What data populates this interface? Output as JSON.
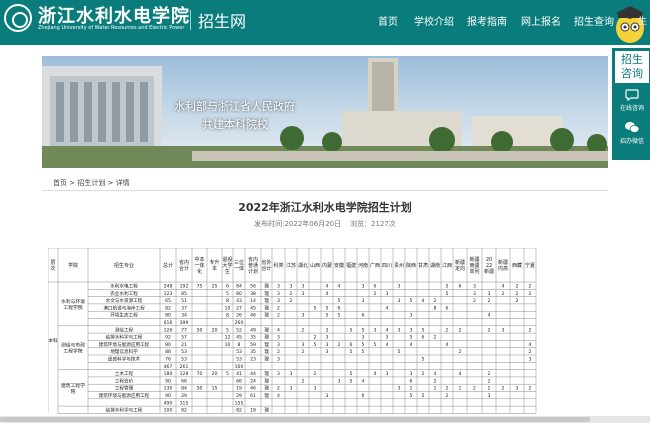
{
  "header": {
    "school_name_cn": "浙江水利水电学院",
    "school_name_en": "Zhejiang University of Water Resources and Electric Power",
    "site_name": "招生网",
    "nav": [
      "首页",
      "学校介绍",
      "报考指南",
      "网上报名",
      "招生查询"
    ],
    "mascot_text": "生"
  },
  "side_panel": {
    "title_line1": "招生",
    "title_line2": "咨询",
    "online": "在线咨询",
    "wechat": "招办微信"
  },
  "banner": {
    "line1": "水利部与浙江省人民政府",
    "line2": "共建本科院校"
  },
  "breadcrumb": [
    "首页",
    "招生计划",
    "详情"
  ],
  "breadcrumb_sep": ">",
  "article": {
    "title": "2022年浙江水利水电学院招生计划",
    "publish_label": "发布时间:2022年06月20日",
    "views": "浏览：2127次"
  },
  "table": {
    "headers": [
      "层次",
      "学院",
      "招生专业",
      "总计",
      "省内合计",
      "中本一体化",
      "专升本",
      "退役大学生",
      "三位一体",
      "省内普通计划",
      "省外合计",
      "科类",
      "江苏",
      "湖北",
      "山西",
      "内蒙",
      "安徽",
      "福建",
      "河南",
      "广西",
      "四川",
      "贵州",
      "陕西",
      "甘肃",
      "湖南",
      "江西",
      "新疆定向",
      "新疆南疆单列",
      "2022新疆",
      "新疆内高",
      "西藏",
      "宁夏"
    ],
    "rows": [
      [
        "",
        "水利与环境工程学院",
        "水利水电工程",
        "248",
        "192",
        "75",
        "25",
        "6",
        "84",
        "56",
        "理",
        "3",
        "3",
        "3",
        "",
        "4",
        "4",
        "",
        "3",
        "6",
        "",
        "3",
        "",
        "",
        "",
        "5",
        "6",
        "3",
        "",
        "4",
        "2",
        "2"
      ],
      [
        "",
        "",
        "农业水利工程",
        "123",
        "85",
        "",
        "",
        "5",
        "80",
        "38",
        "理",
        "3",
        "2",
        "3",
        "",
        "4",
        "",
        "",
        "",
        "2",
        "3",
        "",
        "",
        "",
        "",
        "5",
        "",
        "3",
        "3",
        "2",
        "2",
        "2"
      ],
      [
        "",
        "",
        "水文与水资源工程",
        "65",
        "51",
        "",
        "",
        "8",
        "43",
        "14",
        "理",
        "3",
        "2",
        "",
        "",
        "",
        "5",
        "",
        "3",
        "",
        "",
        "3",
        "5",
        "4",
        "2",
        "",
        "",
        "2",
        "2",
        "",
        "2",
        ""
      ],
      [
        "",
        "",
        "港口航道与海岸工程",
        "82",
        "37",
        "",
        "",
        "10",
        "27",
        "45",
        "理",
        "2",
        "",
        "",
        "5",
        "5",
        "6",
        "",
        "",
        "",
        "4",
        "",
        "",
        "",
        "8",
        "6",
        "",
        "",
        "",
        "",
        "",
        ""
      ],
      [
        "",
        "",
        "环境生态工程",
        "80",
        "34",
        "",
        "",
        "8",
        "26",
        "46",
        "理",
        "2",
        "",
        "3",
        "",
        "5",
        "5",
        "",
        "6",
        "",
        "",
        "",
        "3",
        "",
        "",
        "",
        "",
        "",
        "4",
        "",
        "",
        ""
      ],
      [
        "",
        "",
        "",
        "616",
        "399",
        "",
        "",
        "",
        "260",
        "",
        "",
        "",
        "",
        "",
        "",
        "",
        "",
        "",
        "",
        "",
        "",
        "",
        "",
        "",
        "",
        "",
        "",
        "",
        "",
        "",
        "",
        ""
      ],
      [
        "",
        "测绘与市政工程学院",
        "测绘工程",
        "126",
        "77",
        "50",
        "20",
        "5",
        "52",
        "49",
        "理",
        "4",
        "",
        "2",
        "",
        "3",
        "",
        "5",
        "5",
        "3",
        "4",
        "3",
        "3",
        "5",
        "",
        "2",
        "2",
        "",
        "2",
        "3",
        "",
        "2"
      ],
      [
        "",
        "",
        "给排水科学与工程",
        "92",
        "57",
        "",
        "",
        "12",
        "45",
        "35",
        "理",
        "3",
        "",
        "",
        "2",
        "3",
        "",
        "",
        "3",
        "",
        "3",
        "",
        "5",
        "6",
        "2",
        "",
        "",
        "",
        "",
        "",
        "",
        ""
      ],
      [
        "",
        "",
        "建筑环境与能源应用工程",
        "80",
        "21",
        "",
        "",
        "10",
        "8",
        "59",
        "理",
        "3",
        "",
        "3",
        "5",
        "3",
        "2",
        "6",
        "5",
        "5",
        "4",
        "",
        "4",
        "",
        "",
        "4",
        "",
        "",
        "",
        "",
        "",
        "4"
      ],
      [
        "",
        "",
        "地理信息科学",
        "88",
        "53",
        "",
        "",
        "",
        "53",
        "35",
        "理",
        "2",
        "",
        "2",
        "",
        "3",
        "",
        "5",
        "5",
        "",
        "",
        "5",
        "",
        "",
        "",
        "",
        "2",
        "",
        "",
        "",
        "",
        "2"
      ],
      [
        "",
        "",
        "遥感科学与技术",
        "76",
        "53",
        "",
        "",
        "",
        "53",
        "23",
        "理",
        "3",
        "",
        "",
        "",
        "",
        "",
        "",
        "",
        "",
        "",
        "",
        "",
        "5",
        "",
        "",
        "",
        "",
        "",
        "",
        "",
        "3"
      ],
      [
        "",
        "",
        "",
        "467",
        "261",
        "",
        "",
        "",
        "160",
        "",
        "",
        "",
        "",
        "",
        "",
        "",
        "",
        "",
        "",
        "",
        "",
        "",
        "",
        "",
        "",
        "",
        "",
        "",
        "",
        "",
        "",
        ""
      ],
      [
        "",
        "建筑工程学院",
        "土木工程",
        "180",
        "128",
        "70",
        "20",
        "5",
        "41",
        "44",
        "理",
        "3",
        "3",
        "",
        "2",
        "",
        "",
        "5",
        "",
        "4",
        "3",
        "",
        "3",
        "2",
        "4",
        "",
        "4",
        "",
        "2",
        "",
        "",
        ""
      ],
      [
        "",
        "",
        "工程造价",
        "90",
        "66",
        "",
        "",
        "",
        "66",
        "24",
        "理",
        "",
        "",
        "2",
        "",
        "",
        "3",
        "5",
        "4",
        "",
        "",
        "",
        "6",
        "",
        "2",
        "",
        "",
        "",
        "2",
        "",
        "",
        ""
      ],
      [
        "",
        "",
        "工程管理",
        "130",
        "84",
        "50",
        "15",
        "",
        "19",
        "46",
        "理",
        "2",
        "3",
        "",
        "3",
        "",
        "",
        "",
        "",
        "",
        "",
        "3",
        "2",
        "",
        "2",
        "2",
        "1",
        "2",
        "2",
        "2",
        "3",
        "2"
      ],
      [
        "",
        "",
        "建筑环境与能源应用工程",
        "90",
        "29",
        "",
        "",
        "",
        "29",
        "61",
        "理",
        "4",
        "",
        "",
        "",
        "3",
        "",
        "",
        "6",
        "",
        "",
        "",
        "5",
        "5",
        "",
        "2",
        "",
        "",
        "3",
        "",
        "",
        ""
      ],
      [
        "",
        "",
        "",
        "490",
        "315",
        "",
        "",
        "",
        "155",
        "",
        "",
        "",
        "",
        "",
        "",
        "",
        "",
        "",
        "",
        "",
        "",
        "",
        "",
        "",
        "",
        "",
        "",
        "",
        "",
        "",
        "",
        ""
      ],
      [
        "",
        "",
        "给排水科学与工程",
        "100",
        "82",
        "",
        "",
        "",
        "82",
        "18",
        "理",
        "",
        "",
        "",
        "",
        "",
        "",
        "",
        "",
        "",
        "",
        "",
        "",
        "",
        "",
        "",
        "",
        "",
        "",
        "",
        "",
        ""
      ]
    ],
    "college_spans": [
      {
        "name": "水利与环境工程学院",
        "start": 0,
        "rows": 6
      },
      {
        "name": "测绘与市政工程学院",
        "start": 6,
        "rows": 6
      },
      {
        "name": "建筑工程学院",
        "start": 12,
        "rows": 5
      }
    ],
    "level_label": "本科"
  },
  "colors": {
    "brand": "#0a7c7c",
    "gridline": "#8a8a8a"
  }
}
